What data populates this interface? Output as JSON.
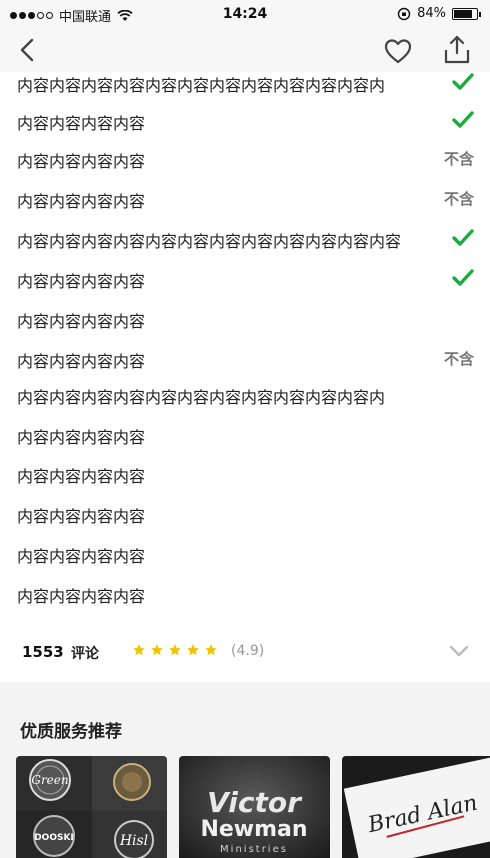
{
  "status_bar": {
    "carrier": "中国联通",
    "time": "14:24",
    "battery": "84%",
    "battery_level": 0.84,
    "signal_bars": 3
  },
  "nav": {
    "back_icon": "chevron-left-icon",
    "favorite_icon": "heart-outline-icon",
    "share_icon": "share-upload-icon"
  },
  "items": [
    {
      "text": "内容内容内容内容内容内容内容内容内容内容内容内",
      "mark": "check"
    },
    {
      "text": "内容内容内容内容",
      "mark": "check"
    },
    {
      "text": "内容内容内容内容",
      "mark": "不含"
    },
    {
      "text": "内容内容内容内容",
      "mark": "不含"
    },
    {
      "text": "内容内容内容内容内容内容内容内容内容内容内容内容",
      "mark": "check"
    },
    {
      "text": "内容内容内容内容",
      "mark": "check"
    },
    {
      "text": "内容内容内容内容",
      "mark": ""
    },
    {
      "text": "内容内容内容内容",
      "mark": "不含"
    },
    {
      "text": "内容内容内容内容内容内容内容内容内容内容内容内",
      "mark": ""
    },
    {
      "text": "内容内容内容内容",
      "mark": ""
    },
    {
      "text": "内容内容内容内容",
      "mark": ""
    },
    {
      "text": "内容内容内容内容",
      "mark": ""
    },
    {
      "text": "内容内容内容内容",
      "mark": ""
    },
    {
      "text": "内容内容内容内容",
      "mark": ""
    }
  ],
  "reviews": {
    "count": "1553",
    "label": "评论",
    "rating": 4.9,
    "rating_text": "(4.9)",
    "stars": 5
  },
  "recommend": {
    "title": "优质服务推荐",
    "cards": [
      {
        "logo_texts": [
          "Green",
          "Hisl",
          "DOOSKI"
        ]
      },
      {
        "logo_texts": [
          "Victor",
          "Newman",
          "Ministries"
        ]
      },
      {
        "logo_texts": [
          "Brad Alan"
        ]
      }
    ]
  },
  "colors": {
    "check": "#1aab3c",
    "star": "#f2c200",
    "muted": "#777777"
  }
}
